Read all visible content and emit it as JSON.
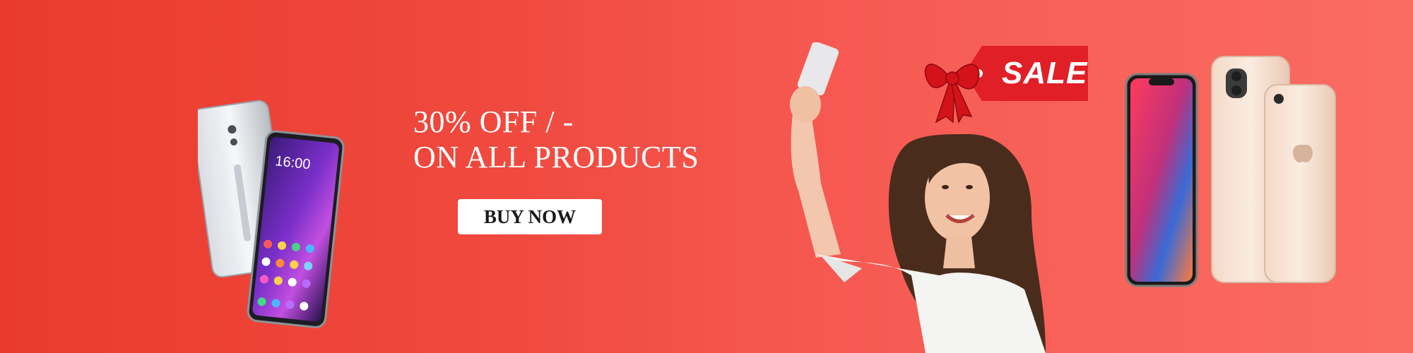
{
  "promo": {
    "line1": "30% OFF / -",
    "line2": "ON ALL PRODUCTS",
    "button_label": "BUY NOW"
  },
  "sale_tag": {
    "label": "SALE"
  },
  "left_phone": {
    "clock": "16:00"
  },
  "colors": {
    "background_start": "#ea3a2e",
    "background_end": "#fa6c62",
    "button_bg": "#ffffff",
    "tag_red": "#e11f27"
  },
  "icons": [
    "vivo-phone-image",
    "woman-selfie-image",
    "sale-bow-tag",
    "iphone-pair-image"
  ]
}
